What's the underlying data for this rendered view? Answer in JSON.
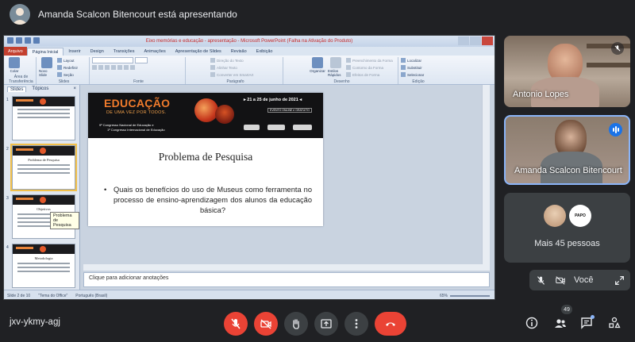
{
  "presenter_bar": {
    "text": "Amanda Scalcon Bitencourt está apresentando"
  },
  "powerpoint": {
    "window_title": "Eixo memórias e educação - apresentação - Microsoft PowerPoint (Falha na Ativação do Produto)",
    "file_tab": "Arquivo",
    "tabs": [
      "Página Inicial",
      "Inserir",
      "Design",
      "Transições",
      "Animações",
      "Apresentação de Slides",
      "Revisão",
      "Exibição"
    ],
    "ribbon": {
      "clipboard_label": "Área de Transferência",
      "paste": "Colar",
      "new_slide": "Novo Slide",
      "slides_label": "Slides",
      "layout": "Layout",
      "reset": "Redefinir",
      "section": "Seção",
      "font_label": "Fonte",
      "paragraph_label": "Parágrafo",
      "text_direction": "Direção do Texto",
      "align_text": "Alinhar Texto",
      "convert_smartart": "Converter em SmartArt",
      "arrange": "Organizar",
      "quick_styles": "Estilos Rápidos",
      "drawing_label": "Desenho",
      "shape_fill": "Preenchimento da Forma",
      "shape_outline": "Contorno da Forma",
      "shape_effects": "Efeitos de Forma",
      "find": "Localizar",
      "replace": "Substituir",
      "select": "Selecionar",
      "editing_label": "Edição"
    },
    "panel_tabs": [
      "Slides",
      "Tópicos"
    ],
    "thumbnails": [
      {
        "num": "1",
        "title": ""
      },
      {
        "num": "2",
        "title": "Problema de Pesquisa"
      },
      {
        "num": "3",
        "title": "Objetivos"
      },
      {
        "num": "4",
        "title": "Metodologia"
      }
    ],
    "tooltip": "Problema de Pesquisa",
    "slide": {
      "banner_title": "EDUCAÇÃO",
      "banner_tagline": "DE UMA VEZ POR TODOS.",
      "banner_dates": "▸ 21 a 25 de junho de 2021 ◂",
      "banner_online": "EVENTO ONLINE e GRATUITO",
      "congress_1": "9º Congresso Nacional de Educação e",
      "congress_2": "1º Congresso Internacional de Educação",
      "title": "Problema de Pesquisa",
      "bullet": "Quais os benefícios do uso de Museus como ferramenta no processo de ensino-aprendizagem dos alunos da educação básica?"
    },
    "notes_placeholder": "Clique para adicionar anotações",
    "status": {
      "slide_count": "Slide 2 de 10",
      "theme": "\"Tema do Office\"",
      "language": "Português (Brasil)",
      "zoom": "65%"
    }
  },
  "participants": [
    {
      "name": "Antonio Lopes",
      "muted": true
    },
    {
      "name": "Amanda Scalcon Bitencourt",
      "speaking": true
    }
  ],
  "more_people": {
    "avatar_text": "PAPO",
    "label": "Mais 45 pessoas"
  },
  "self_view": {
    "label": "Você"
  },
  "meeting": {
    "code": "jxv-ykmy-agj",
    "participants_count": "49"
  },
  "colors": {
    "background": "#202124",
    "control_gray": "#3c4043",
    "danger_red": "#ea4335",
    "accent_blue": "#8ab4f8",
    "banner_orange": "#f07b2c"
  },
  "icons": [
    "mic-off-icon",
    "camera-off-icon",
    "hand-icon",
    "present-icon",
    "more-vert-icon",
    "end-call-icon",
    "info-icon",
    "people-icon",
    "chat-icon",
    "activities-icon",
    "expand-icon"
  ]
}
